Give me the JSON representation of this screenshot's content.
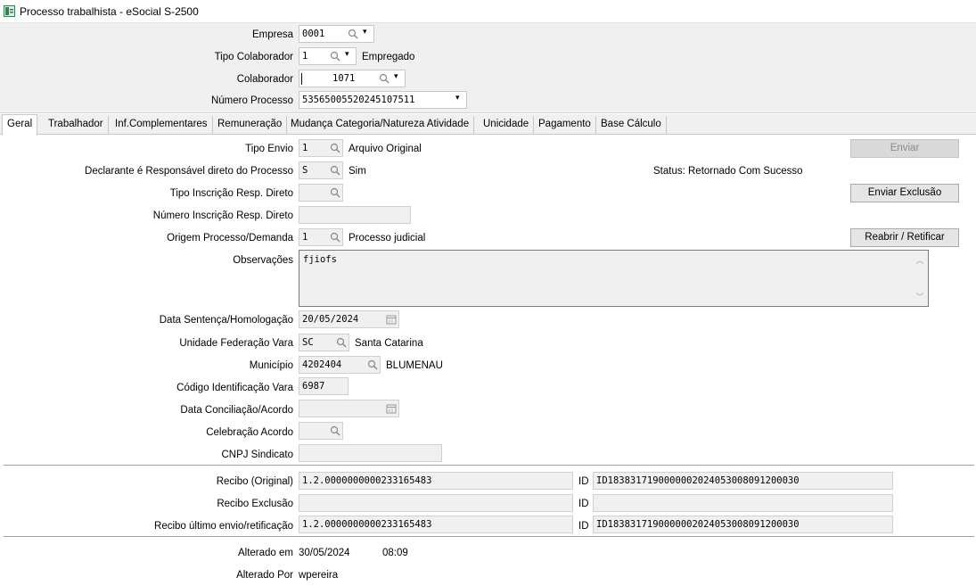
{
  "window": {
    "title": "Processo trabalhista - eSocial S-2500"
  },
  "header": {
    "empresa_label": "Empresa",
    "empresa_value": "0001",
    "tipo_colaborador_label": "Tipo Colaborador",
    "tipo_colaborador_value": "1",
    "tipo_colaborador_desc": "Empregado",
    "colaborador_label": "Colaborador",
    "colaborador_value": "1071",
    "numero_processo_label": "Número Processo",
    "numero_processo_value": "53565005520245107511"
  },
  "tabs": [
    {
      "label": "Geral",
      "active": true
    },
    {
      "label": "Trabalhador"
    },
    {
      "label": "Inf.Complementares"
    },
    {
      "label": "Remuneração"
    },
    {
      "label": "Mudança Categoria/Natureza Atividade"
    },
    {
      "label": "Unicidade"
    },
    {
      "label": "Pagamento"
    },
    {
      "label": "Base Cálculo"
    }
  ],
  "form": {
    "tipo_envio_label": "Tipo Envio",
    "tipo_envio_value": "1",
    "tipo_envio_desc": "Arquivo Original",
    "declarante_label": "Declarante é Responsável direto do Processo",
    "declarante_value": "S",
    "declarante_desc": "Sim",
    "tipo_inscricao_label": "Tipo Inscrição Resp. Direto",
    "tipo_inscricao_value": "",
    "numero_inscricao_label": "Número Inscrição Resp. Direto",
    "numero_inscricao_value": "",
    "origem_label": "Origem Processo/Demanda",
    "origem_value": "1",
    "origem_desc": "Processo judicial",
    "observacoes_label": "Observações",
    "observacoes_value": "fjiofs",
    "data_sentenca_label": "Data Sentença/Homologação",
    "data_sentenca_value": "20/05/2024",
    "uf_vara_label": "Unidade Federação Vara",
    "uf_vara_value": "SC",
    "uf_vara_desc": "Santa Catarina",
    "municipio_label": "Município",
    "municipio_value": "4202404",
    "municipio_desc": "BLUMENAU",
    "codigo_vara_label": "Código Identificação Vara",
    "codigo_vara_value": "6987",
    "data_conciliacao_label": "Data Conciliação/Acordo",
    "data_conciliacao_value": "",
    "celebracao_label": "Celebração Acordo",
    "celebracao_value": "",
    "cnpj_sindicato_label": "CNPJ Sindicato",
    "cnpj_sindicato_value": ""
  },
  "actions": {
    "enviar_label": "Enviar",
    "status_label": "Status:",
    "status_value": "Retornado Com Sucesso",
    "enviar_exclusao_label": "Enviar Exclusão",
    "reabrir_label": "Reabrir / Retificar"
  },
  "recibos": {
    "original_label": "Recibo (Original)",
    "original_value": "1.2.0000000000233165483",
    "original_id_label": "ID",
    "original_id_value": "ID1838317190000002024053008091200030",
    "exclusao_label": "Recibo Exclusão",
    "exclusao_value": "",
    "exclusao_id_label": "ID",
    "exclusao_id_value": "",
    "ultimo_label": "Recibo último envio/retificação",
    "ultimo_value": "1.2.0000000000233165483",
    "ultimo_id_label": "ID",
    "ultimo_id_value": "ID1838317190000002024053008091200030"
  },
  "audit": {
    "alterado_em_label": "Alterado em",
    "alterado_em_date": "30/05/2024",
    "alterado_em_time": "08:09",
    "alterado_por_label": "Alterado Por",
    "alterado_por_value": "wpereira"
  }
}
